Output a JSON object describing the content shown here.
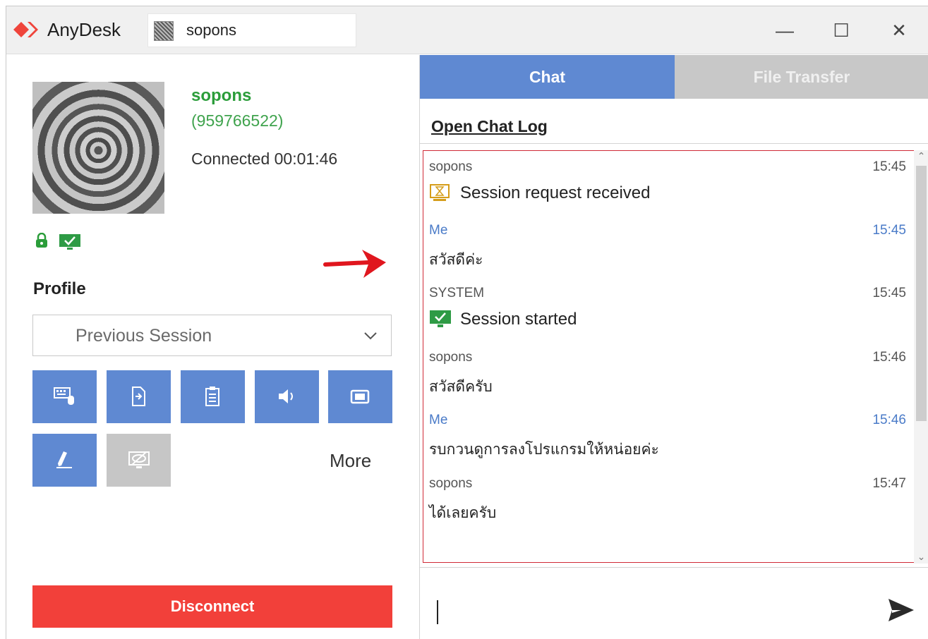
{
  "titlebar": {
    "app_name": "AnyDesk",
    "address_value": "sopons",
    "minimize": "—",
    "maximize": "☐",
    "close": "✕"
  },
  "peer": {
    "name": "sopons",
    "id": "(959766522)",
    "status": "Connected 00:01:46"
  },
  "profile": {
    "label": "Profile",
    "selected": "Previous Session"
  },
  "toolbar": {
    "buttons": [
      "keyboard-mouse-icon",
      "file-send-icon",
      "clipboard-icon",
      "speaker-icon",
      "camera-icon",
      "pen-icon",
      "hide-screen-icon"
    ],
    "more_label": "More"
  },
  "disconnect_label": "Disconnect",
  "tabs": [
    {
      "label": "Chat",
      "active": true
    },
    {
      "label": "File Transfer",
      "active": false
    }
  ],
  "chat": {
    "open_log_label": "Open Chat Log",
    "messages": [
      {
        "sender": "sopons",
        "time": "15:45",
        "text": "Session request received",
        "icon": "hourglass-icon"
      },
      {
        "sender": "Me",
        "time": "15:45",
        "text": "สวัสดีค่ะ"
      },
      {
        "sender": "SYSTEM",
        "time": "15:45",
        "text": "Session started",
        "icon": "monitor-check-icon"
      },
      {
        "sender": "sopons",
        "time": "15:46",
        "text": "สวัสดีครับ"
      },
      {
        "sender": "Me",
        "time": "15:46",
        "text": "รบกวนดูการลงโปรแกรมให้หน่อยค่ะ"
      },
      {
        "sender": "sopons",
        "time": "15:47",
        "text": "ได้เลยครับ"
      }
    ]
  },
  "colors": {
    "accent_blue": "#5f89d2",
    "disconnect_red": "#f2403a",
    "peer_green": "#2b9d3a",
    "annotation_red": "#e0161e",
    "highlight_border": "#d02a36"
  }
}
